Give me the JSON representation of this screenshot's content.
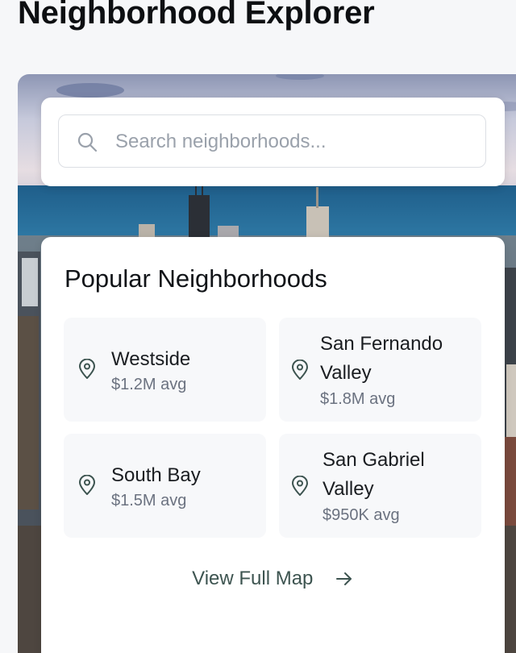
{
  "page": {
    "title": "Neighborhood Explorer"
  },
  "search": {
    "placeholder": "Search neighborhoods...",
    "value": ""
  },
  "popular": {
    "title": "Popular Neighborhoods",
    "items": [
      {
        "name": "Westside",
        "price": "$1.2M avg",
        "icon": "map-pin-icon"
      },
      {
        "name": "San Fernando Valley",
        "price": "$1.8M avg",
        "icon": "map-pin-icon"
      },
      {
        "name": "South Bay",
        "price": "$1.5M avg",
        "icon": "map-pin-icon"
      },
      {
        "name": "San Gabriel Valley",
        "price": "$950K avg",
        "icon": "map-pin-icon"
      }
    ],
    "view_map_label": "View Full Map"
  },
  "colors": {
    "accent": "#3d5450",
    "background": "#f6f7f9",
    "card": "#ffffff",
    "tile": "#f7f8fa"
  }
}
